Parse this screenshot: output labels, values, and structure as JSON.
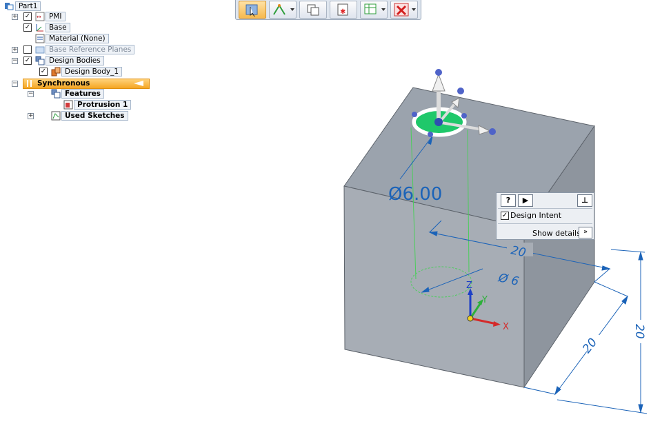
{
  "path_finder": {
    "root": "Part1",
    "items": [
      {
        "label": "PMI",
        "checked": true,
        "expander": "+"
      },
      {
        "label": "Base",
        "checked": true,
        "expander": ""
      },
      {
        "label": "Material (None)",
        "checked": null,
        "expander": ""
      },
      {
        "label": "Base Reference Planes",
        "checked": false,
        "expander": "+"
      },
      {
        "label": "Design Bodies",
        "checked": true,
        "expander": "−"
      },
      {
        "label": "Design Body_1",
        "checked": true,
        "expander": ""
      }
    ],
    "synchronous": "Synchronous",
    "synchronous_expander": "−",
    "features": "Features",
    "features_expander": "−",
    "protrusion": "Protrusion 1",
    "used_sketches": "Used Sketches",
    "used_sketches_expander": "+"
  },
  "toolbar": {
    "buttons": [
      {
        "icon": "select-tool-icon",
        "active": true,
        "dropdown": false
      },
      {
        "icon": "sketch-plane-icon",
        "active": false,
        "dropdown": true
      },
      {
        "icon": "copy-face-icon",
        "active": false,
        "dropdown": false
      },
      {
        "icon": "face-relate-icon",
        "active": false,
        "dropdown": false
      },
      {
        "icon": "table-pattern-icon",
        "active": false,
        "dropdown": true
      },
      {
        "icon": "delete-x-icon",
        "active": false,
        "dropdown": true
      }
    ]
  },
  "viewport": {
    "hole_diameter_callout": "Ø6.00",
    "pmi_dimensions": {
      "width": "20",
      "depth": "20",
      "height": "20",
      "hole": "Ø 6"
    },
    "triad_axes": {
      "x": "X",
      "y": "Y",
      "z": "Z"
    },
    "colors": {
      "cube_top": "#9ba3ad",
      "cube_front": "#a7adb5",
      "cube_right": "#8e959e",
      "dimension": "#1b63b8",
      "sketch": "#4ccd5c",
      "handle_green": "#1fc86a"
    }
  },
  "design_intent": {
    "help_label": "?",
    "play_label": "▶",
    "pin_label": "⊥",
    "checkbox_checked": true,
    "checkbox_label": "Design Intent",
    "show_details": "Show details",
    "expand_label": "»"
  }
}
